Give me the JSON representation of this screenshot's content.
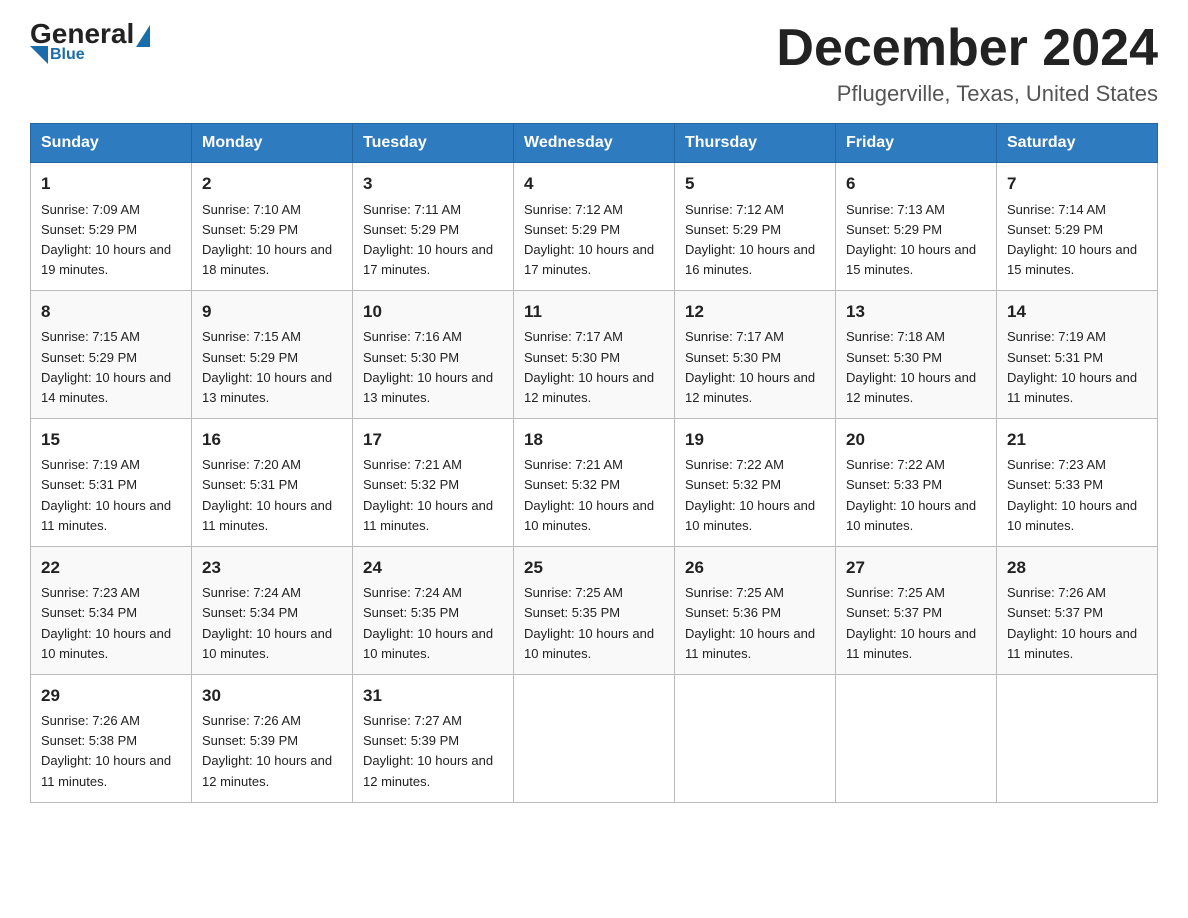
{
  "header": {
    "logo_general": "General",
    "logo_blue": "Blue",
    "month_title": "December 2024",
    "location": "Pflugerville, Texas, United States"
  },
  "calendar": {
    "days_of_week": [
      "Sunday",
      "Monday",
      "Tuesday",
      "Wednesday",
      "Thursday",
      "Friday",
      "Saturday"
    ],
    "weeks": [
      [
        {
          "day": "1",
          "sunrise": "7:09 AM",
          "sunset": "5:29 PM",
          "daylight": "10 hours and 19 minutes."
        },
        {
          "day": "2",
          "sunrise": "7:10 AM",
          "sunset": "5:29 PM",
          "daylight": "10 hours and 18 minutes."
        },
        {
          "day": "3",
          "sunrise": "7:11 AM",
          "sunset": "5:29 PM",
          "daylight": "10 hours and 17 minutes."
        },
        {
          "day": "4",
          "sunrise": "7:12 AM",
          "sunset": "5:29 PM",
          "daylight": "10 hours and 17 minutes."
        },
        {
          "day": "5",
          "sunrise": "7:12 AM",
          "sunset": "5:29 PM",
          "daylight": "10 hours and 16 minutes."
        },
        {
          "day": "6",
          "sunrise": "7:13 AM",
          "sunset": "5:29 PM",
          "daylight": "10 hours and 15 minutes."
        },
        {
          "day": "7",
          "sunrise": "7:14 AM",
          "sunset": "5:29 PM",
          "daylight": "10 hours and 15 minutes."
        }
      ],
      [
        {
          "day": "8",
          "sunrise": "7:15 AM",
          "sunset": "5:29 PM",
          "daylight": "10 hours and 14 minutes."
        },
        {
          "day": "9",
          "sunrise": "7:15 AM",
          "sunset": "5:29 PM",
          "daylight": "10 hours and 13 minutes."
        },
        {
          "day": "10",
          "sunrise": "7:16 AM",
          "sunset": "5:30 PM",
          "daylight": "10 hours and 13 minutes."
        },
        {
          "day": "11",
          "sunrise": "7:17 AM",
          "sunset": "5:30 PM",
          "daylight": "10 hours and 12 minutes."
        },
        {
          "day": "12",
          "sunrise": "7:17 AM",
          "sunset": "5:30 PM",
          "daylight": "10 hours and 12 minutes."
        },
        {
          "day": "13",
          "sunrise": "7:18 AM",
          "sunset": "5:30 PM",
          "daylight": "10 hours and 12 minutes."
        },
        {
          "day": "14",
          "sunrise": "7:19 AM",
          "sunset": "5:31 PM",
          "daylight": "10 hours and 11 minutes."
        }
      ],
      [
        {
          "day": "15",
          "sunrise": "7:19 AM",
          "sunset": "5:31 PM",
          "daylight": "10 hours and 11 minutes."
        },
        {
          "day": "16",
          "sunrise": "7:20 AM",
          "sunset": "5:31 PM",
          "daylight": "10 hours and 11 minutes."
        },
        {
          "day": "17",
          "sunrise": "7:21 AM",
          "sunset": "5:32 PM",
          "daylight": "10 hours and 11 minutes."
        },
        {
          "day": "18",
          "sunrise": "7:21 AM",
          "sunset": "5:32 PM",
          "daylight": "10 hours and 10 minutes."
        },
        {
          "day": "19",
          "sunrise": "7:22 AM",
          "sunset": "5:32 PM",
          "daylight": "10 hours and 10 minutes."
        },
        {
          "day": "20",
          "sunrise": "7:22 AM",
          "sunset": "5:33 PM",
          "daylight": "10 hours and 10 minutes."
        },
        {
          "day": "21",
          "sunrise": "7:23 AM",
          "sunset": "5:33 PM",
          "daylight": "10 hours and 10 minutes."
        }
      ],
      [
        {
          "day": "22",
          "sunrise": "7:23 AM",
          "sunset": "5:34 PM",
          "daylight": "10 hours and 10 minutes."
        },
        {
          "day": "23",
          "sunrise": "7:24 AM",
          "sunset": "5:34 PM",
          "daylight": "10 hours and 10 minutes."
        },
        {
          "day": "24",
          "sunrise": "7:24 AM",
          "sunset": "5:35 PM",
          "daylight": "10 hours and 10 minutes."
        },
        {
          "day": "25",
          "sunrise": "7:25 AM",
          "sunset": "5:35 PM",
          "daylight": "10 hours and 10 minutes."
        },
        {
          "day": "26",
          "sunrise": "7:25 AM",
          "sunset": "5:36 PM",
          "daylight": "10 hours and 11 minutes."
        },
        {
          "day": "27",
          "sunrise": "7:25 AM",
          "sunset": "5:37 PM",
          "daylight": "10 hours and 11 minutes."
        },
        {
          "day": "28",
          "sunrise": "7:26 AM",
          "sunset": "5:37 PM",
          "daylight": "10 hours and 11 minutes."
        }
      ],
      [
        {
          "day": "29",
          "sunrise": "7:26 AM",
          "sunset": "5:38 PM",
          "daylight": "10 hours and 11 minutes."
        },
        {
          "day": "30",
          "sunrise": "7:26 AM",
          "sunset": "5:39 PM",
          "daylight": "10 hours and 12 minutes."
        },
        {
          "day": "31",
          "sunrise": "7:27 AM",
          "sunset": "5:39 PM",
          "daylight": "10 hours and 12 minutes."
        },
        null,
        null,
        null,
        null
      ]
    ]
  }
}
